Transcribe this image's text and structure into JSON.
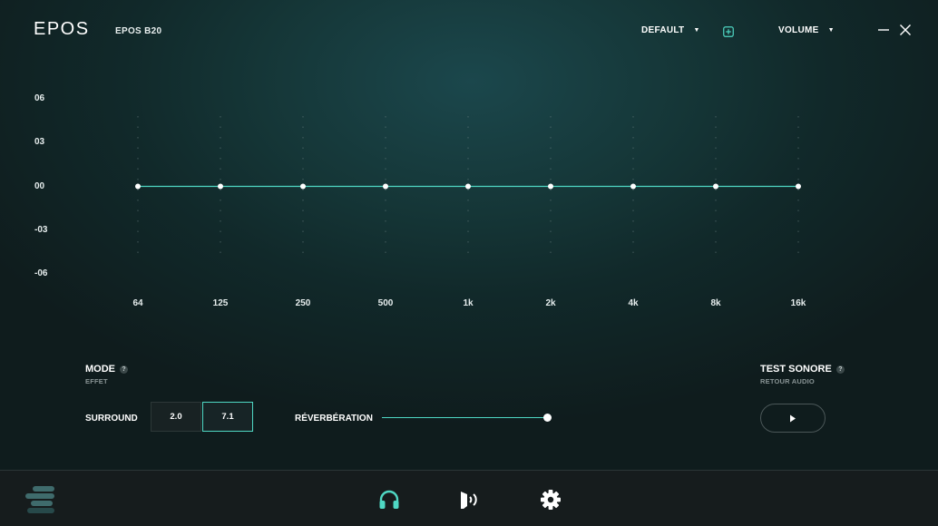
{
  "header": {
    "logo": "EPOS",
    "device_name": "EPOS B20",
    "preset": "DEFAULT",
    "volume": "VOLUME"
  },
  "icons": {
    "add_preset": "plus-square-icon",
    "minimize": "minimize-icon",
    "close": "close-icon",
    "menu": "menu-icon",
    "headphones": "headphones-icon",
    "microphone": "microphone-sidetone-icon",
    "settings": "gear-icon",
    "play": "play-icon"
  },
  "eq": {
    "y_ticks": [
      "06",
      "03",
      "00",
      "-03",
      "-06"
    ],
    "bands": [
      "64",
      "125",
      "250",
      "500",
      "1k",
      "2k",
      "4k",
      "8k",
      "16k"
    ],
    "gains": [
      0,
      0,
      0,
      0,
      0,
      0,
      0,
      0,
      0
    ],
    "range": [
      -6,
      6
    ]
  },
  "mode": {
    "title": "MODE",
    "subtitle": "EFFET",
    "surround_label": "SURROUND",
    "options": [
      "2.0",
      "7.1"
    ],
    "selected": "7.1",
    "reverb_label": "RÉVERBÉRATION",
    "reverb_level": 1.0
  },
  "test": {
    "title": "TEST SONORE",
    "subtitle": "RETOUR AUDIO"
  },
  "colors": {
    "accent": "#4fd8c4",
    "background": "#153637",
    "footer": "#161c1d"
  }
}
